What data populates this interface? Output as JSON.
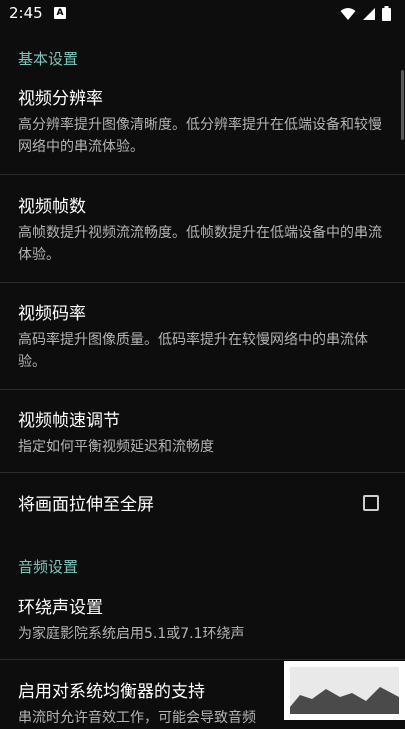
{
  "status": {
    "time": "2:45",
    "notif_glyph": "A"
  },
  "sections": {
    "basic": "基本设置",
    "audio": "音频设置"
  },
  "prefs": {
    "resolution": {
      "title": "视频分辨率",
      "summary": "高分辨率提升图像清晰度。低分辨率提升在低端设备和较慢网络中的串流体验。"
    },
    "fps": {
      "title": "视频帧数",
      "summary": "高帧数提升视频流流畅度。低帧数提升在低端设备中的串流体验。"
    },
    "bitrate": {
      "title": "视频码率",
      "summary": "高码率提升图像质量。低码率提升在较慢网络中的串流体验。"
    },
    "pacing": {
      "title": "视频帧速调节",
      "summary": "指定如何平衡视频延迟和流畅度"
    },
    "stretch": {
      "title": "将画面拉伸至全屏",
      "checked": false
    },
    "surround": {
      "title": "环绕声设置",
      "summary": "为家庭影院系统启用5.1或7.1环绕声"
    },
    "equalizer": {
      "title": "启用对系统均衡器的支持",
      "summary": "串流时允许音效工作，可能会导致音频"
    }
  },
  "colors": {
    "accent": "#7ec4b8",
    "background": "#0d0d0d",
    "summary": "#b3b3b3"
  }
}
